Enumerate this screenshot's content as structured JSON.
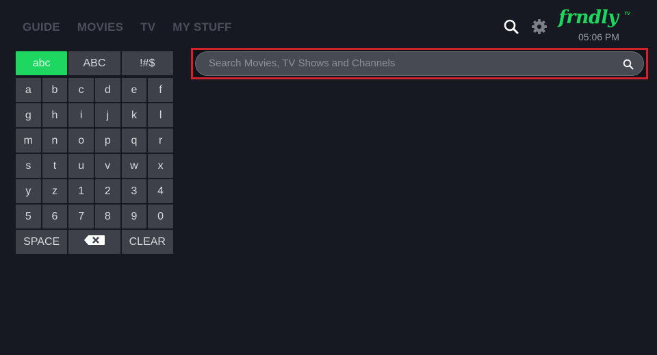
{
  "nav": {
    "items": [
      {
        "label": "GUIDE"
      },
      {
        "label": "MOVIES"
      },
      {
        "label": "TV"
      },
      {
        "label": "MY STUFF"
      }
    ]
  },
  "header": {
    "icons": [
      "search-icon",
      "gear-icon"
    ],
    "logo": "frndly",
    "logo_sup": "TV",
    "time": "05:06 PM",
    "brand_color": "#1ed760"
  },
  "keyboard": {
    "modes": [
      {
        "label": "abc",
        "active": true
      },
      {
        "label": "ABC",
        "active": false
      },
      {
        "label": "!#$",
        "active": false
      }
    ],
    "rows": [
      [
        "a",
        "b",
        "c",
        "d",
        "e",
        "f"
      ],
      [
        "g",
        "h",
        "i",
        "j",
        "k",
        "l"
      ],
      [
        "m",
        "n",
        "o",
        "p",
        "q",
        "r"
      ],
      [
        "s",
        "t",
        "u",
        "v",
        "w",
        "x"
      ],
      [
        "y",
        "z",
        "1",
        "2",
        "3",
        "4"
      ],
      [
        "5",
        "6",
        "7",
        "8",
        "9",
        "0"
      ]
    ],
    "space_label": "SPACE",
    "backspace_icon": "backspace-icon",
    "clear_label": "CLEAR"
  },
  "search": {
    "placeholder": "Search Movies, TV Shows and Channels",
    "value": "",
    "focus_color": "#d0232e"
  }
}
